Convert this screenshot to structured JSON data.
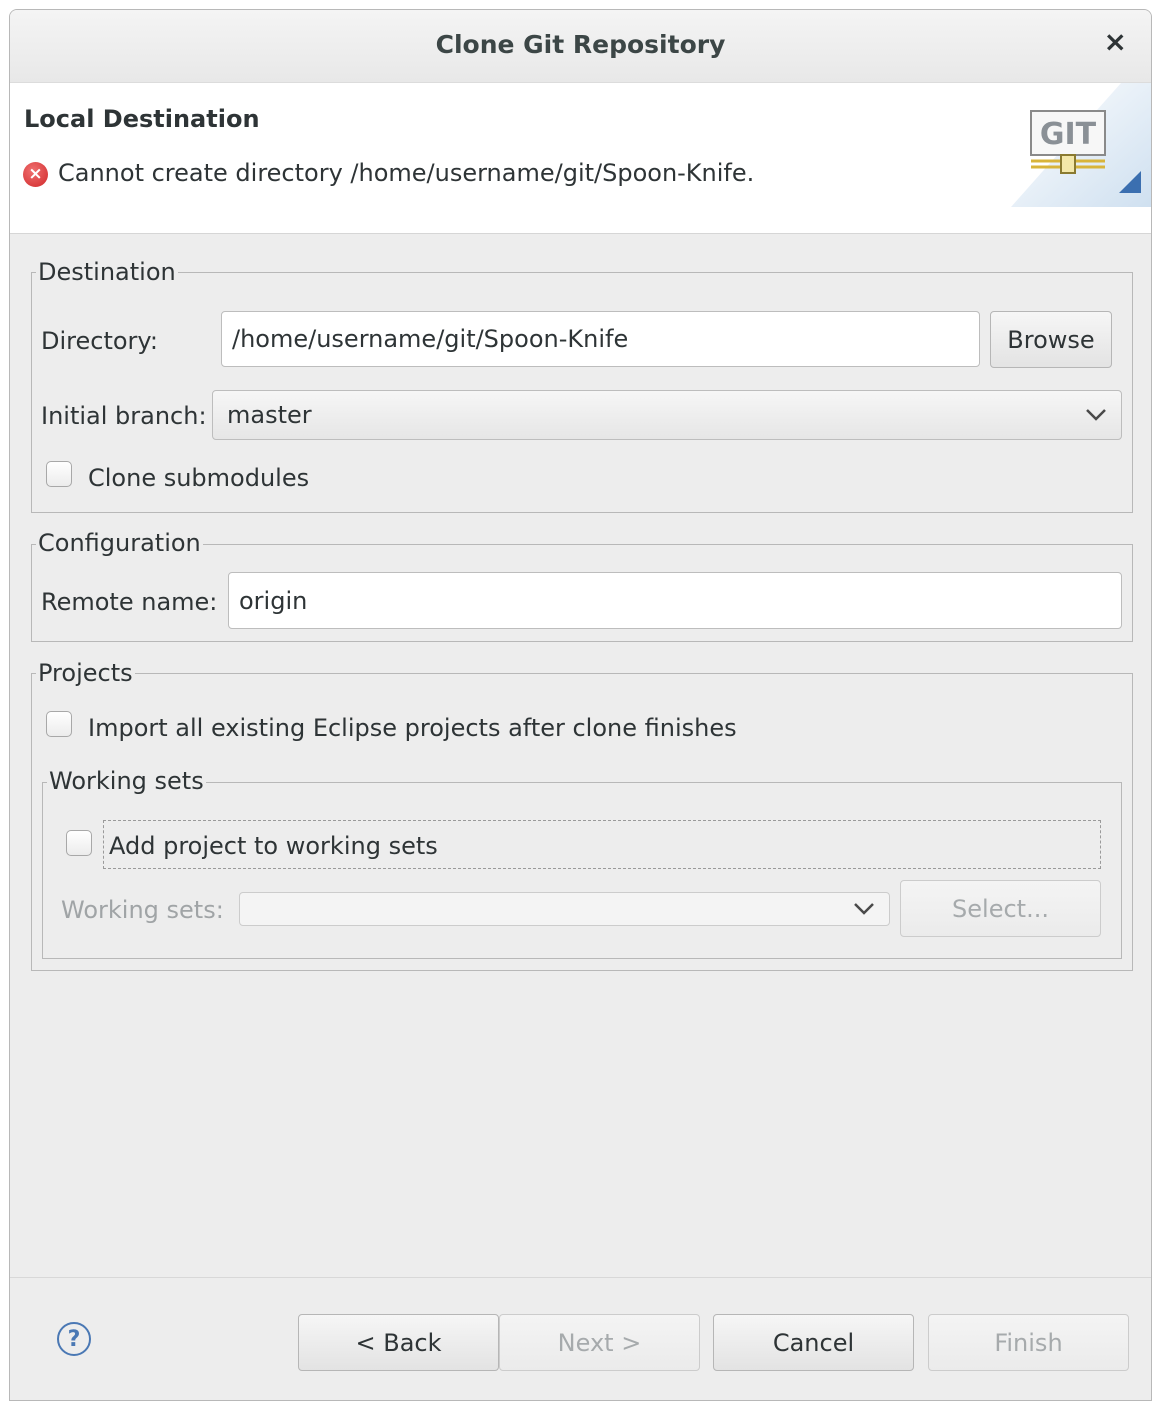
{
  "window": {
    "title": "Clone Git Repository",
    "close_glyph": "×"
  },
  "header": {
    "title": "Local Destination",
    "error_message": "Cannot create directory /home/username/git/Spoon-Knife.",
    "error_glyph": "×",
    "logo_text": "GIT"
  },
  "destination": {
    "group_label": "Destination",
    "directory_label": "Directory:",
    "directory_value": "/home/username/git/Spoon-Knife",
    "browse_label": "Browse",
    "branch_label": "Initial branch:",
    "branch_value": "master",
    "clone_submodules_label": "Clone submodules",
    "clone_submodules_checked": false
  },
  "configuration": {
    "group_label": "Configuration",
    "remote_name_label": "Remote name:",
    "remote_name_value": "origin"
  },
  "projects": {
    "group_label": "Projects",
    "import_label": "Import all existing Eclipse projects after clone finishes",
    "import_checked": false,
    "working_sets": {
      "group_label": "Working sets",
      "add_label": "Add project to working sets",
      "add_checked": false,
      "sets_label": "Working sets:",
      "sets_value": "",
      "select_label": "Select..."
    }
  },
  "footer": {
    "help_glyph": "?",
    "back_label": "< Back",
    "next_label": "Next >",
    "cancel_label": "Cancel",
    "finish_label": "Finish"
  },
  "colors": {
    "error": "#d0282a",
    "help": "#4a78b4",
    "disabled_text": "#a6aaac"
  },
  "icons": [
    "close-icon",
    "error-icon",
    "git-logo-icon",
    "chevron-down-icon",
    "help-icon"
  ]
}
